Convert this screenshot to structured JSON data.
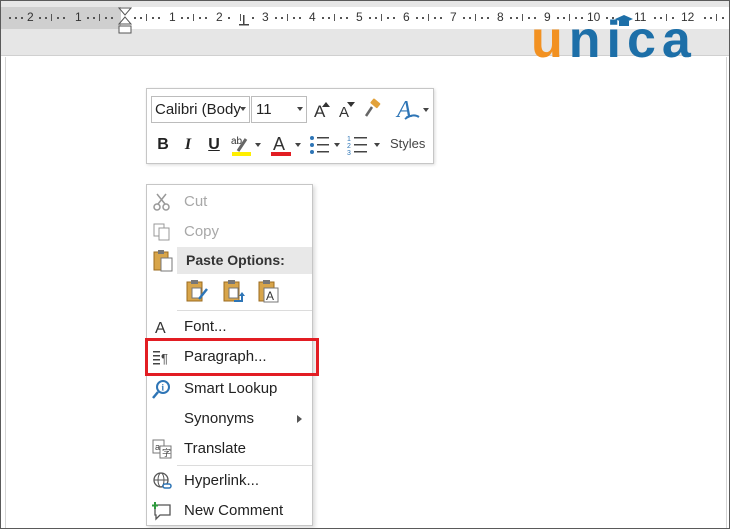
{
  "ruler": {
    "numbers": [
      "2",
      "1",
      "1",
      "2",
      "3",
      "4",
      "5",
      "6",
      "7",
      "8",
      "9",
      "10",
      "11",
      "12"
    ]
  },
  "logo": {
    "u": "u",
    "rest": "nica"
  },
  "mini_toolbar": {
    "font_name": "Calibri (Body",
    "font_size": "11",
    "bold": "B",
    "italic": "I",
    "underline": "U",
    "styles_label": "Styles",
    "highlight_color": "#ffef00",
    "font_color": "#e21d23"
  },
  "context_menu": {
    "cut": "Cut",
    "copy": "Copy",
    "paste_options": "Paste Options:",
    "font": "Font...",
    "paragraph": "Paragraph...",
    "smart_lookup": "Smart Lookup",
    "synonyms": "Synonyms",
    "translate": "Translate",
    "hyperlink": "Hyperlink...",
    "new_comment": "New Comment"
  },
  "colors": {
    "highlight_border": "#e21d23",
    "logo_blue": "#1d6fa8",
    "logo_orange": "#f29121"
  }
}
